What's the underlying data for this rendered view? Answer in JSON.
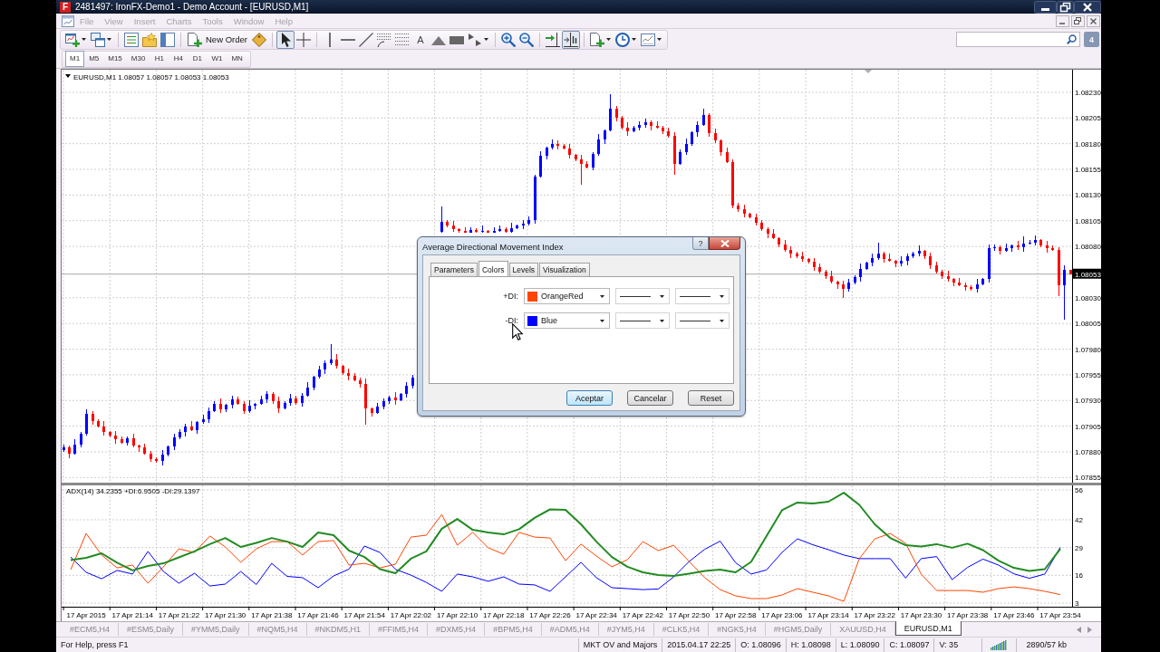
{
  "window": {
    "logo": "F",
    "title": "2481497: IronFX-Demo1 - Demo Account - [EURUSD,M1]"
  },
  "menu": [
    {
      "label": "File",
      "disabled": true
    },
    {
      "label": "View",
      "disabled": true
    },
    {
      "label": "Insert",
      "disabled": true
    },
    {
      "label": "Charts",
      "disabled": true
    },
    {
      "label": "Tools",
      "disabled": true
    },
    {
      "label": "Window",
      "disabled": true
    },
    {
      "label": "Help",
      "disabled": true
    }
  ],
  "toolbar": [
    {
      "kind": "tool",
      "selected": false,
      "dropdown": true
    },
    {
      "kind": "tool",
      "selected": false,
      "dropdown": true
    },
    {
      "kind": "separator"
    },
    {
      "kind": "tool",
      "selected": false
    },
    {
      "kind": "tool",
      "selected": false
    },
    {
      "kind": "tool",
      "selected": false
    },
    {
      "kind": "separator"
    },
    {
      "kind": "button",
      "label": "New Order"
    },
    {
      "kind": "tool",
      "selected": false
    },
    {
      "kind": "separator"
    },
    {
      "kind": "tool",
      "selected": true
    },
    {
      "kind": "tool",
      "selected": false
    },
    {
      "kind": "separator"
    },
    {
      "kind": "tool",
      "selected": false
    },
    {
      "kind": "tool",
      "selected": false
    },
    {
      "kind": "tool",
      "selected": false
    },
    {
      "kind": "tool",
      "selected": false
    },
    {
      "kind": "tool",
      "selected": false
    },
    {
      "kind": "text",
      "label": "A",
      "selected": false
    },
    {
      "kind": "tool",
      "selected": false
    },
    {
      "kind": "tool",
      "selected": false
    },
    {
      "kind": "tool",
      "selected": false,
      "dropdown": true
    },
    {
      "kind": "separator"
    },
    {
      "kind": "tool",
      "selected": false
    },
    {
      "kind": "tool",
      "selected": false
    },
    {
      "kind": "separator"
    },
    {
      "kind": "tool",
      "selected": false
    },
    {
      "kind": "tool",
      "selected": true
    },
    {
      "kind": "separator"
    },
    {
      "kind": "tool",
      "selected": false,
      "dropdown": true
    },
    {
      "kind": "tool",
      "selected": false,
      "dropdown": true
    },
    {
      "kind": "tool",
      "selected": false,
      "dropdown": true
    }
  ],
  "messages": {
    "count": "4"
  },
  "timeframes": [
    {
      "label": "M1",
      "selected": true
    },
    {
      "label": "M5",
      "selected": false
    },
    {
      "label": "M15",
      "selected": false
    },
    {
      "label": "M30",
      "selected": false
    },
    {
      "label": "H1",
      "selected": false
    },
    {
      "label": "H4",
      "selected": false
    },
    {
      "label": "D1",
      "selected": false
    },
    {
      "label": "W1",
      "selected": false
    },
    {
      "label": "MN",
      "selected": false
    }
  ],
  "chart": {
    "header": "EURUSD,M1 1.08057 1.08057 1.08053 1.08053",
    "chart_data": {
      "type": "candlestick",
      "grid": true,
      "ylim": [
        1.0785,
        1.08252
      ],
      "yticks": [
        {
          "value": 1.0823,
          "label": "1.08230"
        },
        {
          "value": 1.08205,
          "label": "1.08205"
        },
        {
          "value": 1.0818,
          "label": "1.08180"
        },
        {
          "value": 1.08155,
          "label": "1.08155"
        },
        {
          "value": 1.0813,
          "label": "1.08130"
        },
        {
          "value": 1.08105,
          "label": "1.08105"
        },
        {
          "value": 1.0808,
          "label": "1.08080"
        },
        {
          "value": 1.0803,
          "label": "1.08030"
        },
        {
          "value": 1.08005,
          "label": "1.08005"
        },
        {
          "value": 1.0798,
          "label": "1.07980"
        },
        {
          "value": 1.07955,
          "label": "1.07955"
        },
        {
          "value": 1.0793,
          "label": "1.07930"
        },
        {
          "value": 1.07905,
          "label": "1.07905"
        },
        {
          "value": 1.0788,
          "label": "1.07880"
        },
        {
          "value": 1.07855,
          "label": "1.07855"
        }
      ],
      "ref_lines": [
        {
          "axis": "y",
          "value": 1.08053,
          "label": "1.08053"
        }
      ],
      "categories": [
        null,
        null,
        null,
        null,
        null,
        null,
        null,
        null,
        null,
        null,
        null,
        null,
        null,
        null,
        null,
        null,
        null,
        null,
        null,
        null,
        null,
        null,
        null,
        null,
        null,
        null,
        null,
        null,
        null,
        null,
        null,
        null,
        null,
        null,
        null,
        null,
        null,
        null,
        null,
        null,
        null,
        null,
        null,
        null,
        null,
        null,
        null,
        null,
        null,
        null,
        null,
        null,
        null,
        null,
        null,
        null,
        null,
        null,
        null,
        null,
        null,
        null,
        null,
        null,
        null,
        null,
        null,
        null,
        null,
        null,
        null,
        null,
        null,
        null,
        null,
        null,
        null,
        null,
        null,
        null,
        null,
        null,
        null,
        null,
        null,
        null,
        null,
        null,
        null,
        null,
        null,
        null,
        null,
        null,
        null,
        null,
        null,
        null,
        null,
        null,
        null,
        null,
        null,
        null,
        null,
        null,
        null,
        null,
        null,
        null,
        null,
        null,
        null,
        null,
        null,
        null,
        null,
        null,
        null,
        null,
        null,
        null,
        null,
        null,
        null,
        null,
        null,
        null,
        null,
        null,
        null,
        null,
        null,
        null,
        null,
        null,
        null,
        null,
        null,
        null,
        null,
        null,
        null,
        null,
        null,
        null,
        null,
        null,
        null,
        null,
        null,
        null,
        null,
        null,
        null,
        null,
        null,
        null,
        null,
        null,
        null,
        null,
        null,
        null,
        null,
        null,
        null,
        null,
        null,
        null,
        null,
        null,
        null,
        null
      ],
      "ohlc": [
        [
          1.07882,
          1.07887,
          1.0788,
          1.07884
        ],
        [
          1.07884,
          1.07886,
          1.07874,
          1.07878
        ],
        [
          1.07878,
          1.07892,
          1.07877,
          1.07887
        ],
        [
          1.07887,
          1.07899,
          1.07884,
          1.07898
        ],
        [
          1.07898,
          1.07921,
          1.07896,
          1.07917
        ],
        [
          1.07917,
          1.0792,
          1.07906,
          1.0791
        ],
        [
          1.0791,
          1.07912,
          1.07904,
          1.07905
        ],
        [
          1.07905,
          1.0791,
          1.07896,
          1.07899
        ],
        [
          1.07899,
          1.079,
          1.07894,
          1.07896
        ],
        [
          1.07896,
          1.079,
          1.07888,
          1.07892
        ],
        [
          1.07892,
          1.07895,
          1.07888,
          1.07889
        ],
        [
          1.07889,
          1.07895,
          1.07886,
          1.07893
        ],
        [
          1.07893,
          1.07898,
          1.07884,
          1.07886
        ],
        [
          1.07886,
          1.07887,
          1.0788,
          1.07884
        ],
        [
          1.07884,
          1.07888,
          1.07877,
          1.07878
        ],
        [
          1.07878,
          1.07881,
          1.0787,
          1.07873
        ],
        [
          1.07873,
          1.07875,
          1.07869,
          1.07871
        ],
        [
          1.07871,
          1.07882,
          1.07867,
          1.07877
        ],
        [
          1.07877,
          1.07886,
          1.07876,
          1.07885
        ],
        [
          1.07885,
          1.07898,
          1.07882,
          1.07894
        ],
        [
          1.07894,
          1.07902,
          1.07892,
          1.07899
        ],
        [
          1.07899,
          1.07907,
          1.07895,
          1.07905
        ],
        [
          1.07905,
          1.0791,
          1.079,
          1.07901
        ],
        [
          1.07901,
          1.0791,
          1.07898,
          1.07909
        ],
        [
          1.07909,
          1.07916,
          1.07907,
          1.07912
        ],
        [
          1.07912,
          1.07923,
          1.07908,
          1.0792
        ],
        [
          1.0792,
          1.07929,
          1.07919,
          1.07927
        ],
        [
          1.07927,
          1.07932,
          1.07918,
          1.07921
        ],
        [
          1.07921,
          1.07927,
          1.07919,
          1.07926
        ],
        [
          1.07926,
          1.07935,
          1.07922,
          1.07931
        ],
        [
          1.07931,
          1.07934,
          1.07926,
          1.07927
        ],
        [
          1.07927,
          1.07929,
          1.07917,
          1.0792
        ],
        [
          1.0792,
          1.0793,
          1.07918,
          1.07925
        ],
        [
          1.07925,
          1.07928,
          1.07921,
          1.07927
        ],
        [
          1.07927,
          1.07935,
          1.07926,
          1.07931
        ],
        [
          1.07931,
          1.07939,
          1.07928,
          1.07936
        ],
        [
          1.07936,
          1.07938,
          1.07927,
          1.07929
        ],
        [
          1.07929,
          1.07934,
          1.07918,
          1.07922
        ],
        [
          1.07922,
          1.07929,
          1.07921,
          1.07928
        ],
        [
          1.07928,
          1.07936,
          1.07925,
          1.07932
        ],
        [
          1.07932,
          1.07935,
          1.07926,
          1.07928
        ],
        [
          1.07928,
          1.07937,
          1.07924,
          1.07935
        ],
        [
          1.07935,
          1.07948,
          1.07934,
          1.07943
        ],
        [
          1.07943,
          1.07954,
          1.0794,
          1.07953
        ],
        [
          1.07953,
          1.07964,
          1.07951,
          1.0796
        ],
        [
          1.0796,
          1.07969,
          1.07956,
          1.07966
        ],
        [
          1.07966,
          1.07985,
          1.07965,
          1.0797
        ],
        [
          1.0797,
          1.07975,
          1.07961,
          1.07964
        ],
        [
          1.07964,
          1.07965,
          1.07955,
          1.07957
        ],
        [
          1.07957,
          1.07961,
          1.0795,
          1.07954
        ],
        [
          1.07954,
          1.07957,
          1.07949,
          1.0795
        ],
        [
          1.0795,
          1.07952,
          1.07943,
          1.07946
        ],
        [
          1.07946,
          1.07951,
          1.07906,
          1.07922
        ],
        [
          1.07922,
          1.07923,
          1.07914,
          1.07918
        ],
        [
          1.07918,
          1.07928,
          1.07917,
          1.07924
        ],
        [
          1.07924,
          1.07932,
          1.07921,
          1.07929
        ],
        [
          1.07929,
          1.07935,
          1.07927,
          1.07933
        ],
        [
          1.07933,
          1.07938,
          1.07926,
          1.0793
        ],
        [
          1.0793,
          1.07937,
          1.07929,
          1.07936
        ],
        [
          1.07936,
          1.07948,
          1.07933,
          1.07944
        ],
        [
          1.07944,
          1.07955,
          1.07942,
          1.07952
        ],
        null,
        null,
        null,
        null,
        [
          1.08094,
          1.08119,
          1.08093,
          1.08104
        ],
        [
          1.08104,
          1.08106,
          1.08099,
          1.081
        ],
        [
          1.081,
          1.08105,
          1.08094,
          1.08097
        ],
        [
          1.08097,
          1.08098,
          1.08093,
          1.08095
        ],
        [
          1.08095,
          1.08099,
          1.08093,
          1.08093
        ],
        [
          1.08093,
          1.08099,
          1.08093,
          1.08096
        ],
        [
          1.08096,
          1.08098,
          1.08093,
          1.08094
        ],
        [
          1.08094,
          1.081,
          1.08093,
          1.08095
        ],
        [
          1.08095,
          1.08096,
          1.08093,
          1.08093
        ],
        [
          1.08093,
          1.08099,
          1.08093,
          1.08095
        ],
        [
          1.08095,
          1.081,
          1.08094,
          1.08097
        ],
        [
          1.08097,
          1.08099,
          1.08093,
          1.08094
        ],
        [
          1.08094,
          1.08103,
          1.08093,
          1.08098
        ],
        [
          1.08098,
          1.08101,
          1.08097,
          1.081
        ],
        [
          1.081,
          1.08106,
          1.08097,
          1.08102
        ],
        [
          1.08102,
          1.08109,
          1.081,
          1.08106
        ],
        [
          1.08106,
          1.0815,
          1.08102,
          1.08148
        ],
        [
          1.08148,
          1.08173,
          1.08147,
          1.08168
        ],
        [
          1.08168,
          1.08177,
          1.08165,
          1.08176
        ],
        [
          1.08176,
          1.08184,
          1.08174,
          1.0818
        ],
        [
          1.0818,
          1.08183,
          1.08174,
          1.08178
        ],
        [
          1.08178,
          1.0818,
          1.08174,
          1.08175
        ],
        [
          1.08175,
          1.0818,
          1.08166,
          1.08169
        ],
        [
          1.08169,
          1.0817,
          1.08163,
          1.08165
        ],
        [
          1.08165,
          1.08169,
          1.0814,
          1.0816
        ],
        [
          1.0816,
          1.08163,
          1.08156,
          1.08157
        ],
        [
          1.08157,
          1.08172,
          1.08154,
          1.0817
        ],
        [
          1.0817,
          1.08189,
          1.08168,
          1.08184
        ],
        [
          1.08184,
          1.08194,
          1.0818,
          1.08193
        ],
        [
          1.08193,
          1.08228,
          1.08192,
          1.08214
        ],
        [
          1.08214,
          1.08217,
          1.08202,
          1.08205
        ],
        [
          1.08205,
          1.08207,
          1.08194,
          1.08196
        ],
        [
          1.08196,
          1.08201,
          1.08188,
          1.08192
        ],
        [
          1.08192,
          1.08197,
          1.08191,
          1.08196
        ],
        [
          1.08196,
          1.08202,
          1.08193,
          1.08198
        ],
        [
          1.08198,
          1.08204,
          1.08196,
          1.08201
        ],
        [
          1.08201,
          1.08203,
          1.08193,
          1.08197
        ],
        [
          1.08197,
          1.08202,
          1.08195,
          1.08196
        ],
        [
          1.08196,
          1.08197,
          1.08189,
          1.08192
        ],
        [
          1.08192,
          1.08196,
          1.08186,
          1.08188
        ],
        [
          1.08188,
          1.08191,
          1.0815,
          1.0816
        ],
        [
          1.0816,
          1.08174,
          1.08159,
          1.08172
        ],
        [
          1.08172,
          1.08185,
          1.08169,
          1.0818
        ],
        [
          1.0818,
          1.08192,
          1.08178,
          1.08191
        ],
        [
          1.08191,
          1.08202,
          1.08187,
          1.08198
        ],
        [
          1.08198,
          1.08214,
          1.08197,
          1.08208
        ],
        [
          1.08208,
          1.0821,
          1.08187,
          1.0819
        ],
        [
          1.0819,
          1.08195,
          1.08181,
          1.08183
        ],
        [
          1.08183,
          1.08184,
          1.08168,
          1.08172
        ],
        [
          1.08172,
          1.08176,
          1.08161,
          1.08162
        ],
        [
          1.08162,
          1.08165,
          1.08117,
          1.0812
        ],
        [
          1.0812,
          1.08122,
          1.08114,
          1.08116
        ],
        [
          1.08116,
          1.08121,
          1.08108,
          1.08112
        ],
        [
          1.08112,
          1.08113,
          1.08107,
          1.08108
        ],
        [
          1.08108,
          1.08112,
          1.081,
          1.08103
        ],
        [
          1.08103,
          1.08106,
          1.08095,
          1.08097
        ],
        [
          1.08097,
          1.08099,
          1.08088,
          1.08092
        ],
        [
          1.08092,
          1.08097,
          1.08087,
          1.08088
        ],
        [
          1.08088,
          1.08089,
          1.08079,
          1.08082
        ],
        [
          1.08082,
          1.08086,
          1.08075,
          1.08077
        ],
        [
          1.08077,
          1.0808,
          1.08069,
          1.08073
        ],
        [
          1.08073,
          1.08075,
          1.08069,
          1.0807
        ],
        [
          1.0807,
          1.08075,
          1.08065,
          1.08068
        ],
        [
          1.08068,
          1.08069,
          1.08063,
          1.08065
        ],
        [
          1.08065,
          1.08069,
          1.08056,
          1.0806
        ],
        [
          1.0806,
          1.08063,
          1.08054,
          1.08055
        ],
        [
          1.08055,
          1.08057,
          1.08048,
          1.08051
        ],
        [
          1.08051,
          1.08056,
          1.08044,
          1.08046
        ],
        [
          1.08046,
          1.08047,
          1.08039,
          1.08043
        ],
        [
          1.08043,
          1.08047,
          1.0803,
          1.08039
        ],
        [
          1.08039,
          1.08048,
          1.08036,
          1.08045
        ],
        [
          1.08045,
          1.08052,
          1.08043,
          1.0805
        ],
        [
          1.0805,
          1.08063,
          1.08046,
          1.08058
        ],
        [
          1.08058,
          1.08065,
          1.08057,
          1.08064
        ],
        [
          1.08064,
          1.08073,
          1.08061,
          1.08069
        ],
        [
          1.08069,
          1.08084,
          1.08067,
          1.08073
        ],
        [
          1.08073,
          1.08075,
          1.08064,
          1.08068
        ],
        [
          1.08068,
          1.08073,
          1.08065,
          1.08066
        ],
        [
          1.08066,
          1.08067,
          1.0806,
          1.08063
        ],
        [
          1.08063,
          1.0807,
          1.08061,
          1.08066
        ],
        [
          1.08066,
          1.08073,
          1.08062,
          1.0807
        ],
        [
          1.0807,
          1.08075,
          1.08069,
          1.08073
        ],
        [
          1.08073,
          1.08081,
          1.0807,
          1.08076
        ],
        [
          1.08076,
          1.08077,
          1.08068,
          1.0807
        ],
        [
          1.0807,
          1.08074,
          1.08058,
          1.08062
        ],
        [
          1.08062,
          1.08065,
          1.08054,
          1.08055
        ],
        [
          1.08055,
          1.08057,
          1.08048,
          1.08051
        ],
        [
          1.08051,
          1.08056,
          1.08046,
          1.08048
        ],
        [
          1.08048,
          1.08049,
          1.08041,
          1.08045
        ],
        [
          1.08045,
          1.08049,
          1.08041,
          1.08042
        ],
        [
          1.08042,
          1.08045,
          1.08037,
          1.0804
        ],
        [
          1.0804,
          1.08042,
          1.08037,
          1.08039
        ],
        [
          1.08039,
          1.08048,
          1.08035,
          1.08043
        ],
        [
          1.08043,
          1.08049,
          1.08042,
          1.08048
        ],
        [
          1.08048,
          1.08082,
          1.08045,
          1.08078
        ],
        [
          1.08078,
          1.08082,
          1.08076,
          1.08079
        ],
        [
          1.08079,
          1.08081,
          1.08072,
          1.08076
        ],
        [
          1.08076,
          1.08083,
          1.08075,
          1.08078
        ],
        [
          1.08078,
          1.08082,
          1.08075,
          1.08081
        ],
        [
          1.08081,
          1.08085,
          1.08077,
          1.08079
        ],
        [
          1.08079,
          1.0809,
          1.08075,
          1.08083
        ],
        [
          1.08083,
          1.08086,
          1.08082,
          1.08084
        ],
        [
          1.08084,
          1.08091,
          1.08081,
          1.08086
        ],
        [
          1.08086,
          1.08087,
          1.08079,
          1.08081
        ],
        [
          1.08081,
          1.08085,
          1.08074,
          1.08078
        ],
        [
          1.08078,
          1.08081,
          1.08076,
          1.08077
        ],
        [
          1.08077,
          1.08079,
          1.08032,
          1.08042
        ],
        [
          1.08042,
          1.08062,
          1.08009,
          1.08057
        ],
        [
          1.08057,
          1.08057,
          1.08053,
          1.08053
        ]
      ]
    }
  },
  "indicator": {
    "chart_data": {
      "type": "line",
      "grid": true,
      "title": "ADX(14) 34.2355 +DI:6.9505 -DI:29.1397",
      "ylim": [
        1.3,
        57.7
      ],
      "yticks": [
        3,
        16,
        29,
        42,
        56
      ],
      "categories": [
        null,
        "17 Apr 2015",
        null,
        null,
        "17 Apr 21:14",
        null,
        null,
        "17 Apr 21:22",
        null,
        null,
        "17 Apr 21:30",
        null,
        null,
        "17 Apr 21:38",
        null,
        null,
        "17 Apr 21:46",
        null,
        null,
        "17 Apr 21:54",
        null,
        null,
        "17 Apr 22:02",
        null,
        null,
        "17 Apr 22:10",
        null,
        null,
        "17 Apr 22:18",
        null,
        null,
        "17 Apr 22:26",
        null,
        null,
        "17 Apr 22:34",
        null,
        null,
        "17 Apr 22:42",
        null,
        null,
        "17 Apr 22:50",
        null,
        null,
        "17 Apr 22:58",
        null,
        null,
        "17 Apr 23:06",
        null,
        null,
        "17 Apr 23:14",
        null,
        null,
        "17 Apr 23:22",
        null,
        null,
        "17 Apr 23:30",
        null,
        null,
        "17 Apr 23:38",
        null,
        null,
        "17 Apr 23:46",
        null,
        null,
        "17 Apr 23:54"
      ],
      "series": [
        {
          "color": "#228b22",
          "values": [
            23.1,
            24.2,
            26.3,
            21.9,
            18.3,
            20.4,
            21.6,
            24.4,
            27.2,
            30.6,
            33.5,
            29.3,
            31.2,
            33.5,
            31.8,
            29.3,
            36.1,
            34.8,
            27.6,
            24.6,
            18.9,
            17.0,
            23.8,
            27.2,
            37.8,
            42.4,
            37.3,
            36.1,
            35.2,
            37.6,
            42.9,
            46.9,
            46.7,
            39.9,
            31.8,
            24.6,
            20.0,
            17.4,
            16.1,
            15.7,
            16.8,
            18.0,
            18.7,
            17.4,
            22.3,
            34.4,
            46.5,
            50.1,
            49.6,
            50.5,
            54.7,
            49.0,
            39.9,
            33.5,
            30.1,
            29.5,
            30.6,
            28.9,
            30.8,
            27.8,
            22.9,
            19.5,
            18.0,
            18.9,
            28.4
          ]
        },
        {
          "color": "#ff4500",
          "values": [
            18.7,
            35.6,
            25.5,
            19.5,
            20.8,
            12.3,
            20.0,
            28.4,
            26.7,
            34.4,
            29.3,
            22.1,
            28.4,
            31.8,
            31.8,
            25.5,
            31.8,
            32.3,
            20.8,
            21.6,
            19.5,
            21.2,
            33.9,
            34.8,
            44.5,
            30.1,
            36.1,
            28.9,
            25.9,
            36.1,
            33.9,
            33.5,
            22.9,
            30.6,
            25.0,
            20.0,
            23.3,
            31.8,
            27.6,
            30.1,
            22.5,
            14.9,
            9.3,
            6.4,
            5.1,
            5.1,
            6.8,
            9.8,
            8.1,
            6.4,
            3.8,
            23.8,
            33.1,
            35.6,
            31.0,
            16.6,
            8.9,
            8.9,
            8.9,
            8.1,
            9.8,
            10.6,
            9.8,
            8.5,
            7.0
          ]
        },
        {
          "color": "#0000ff",
          "values": [
            24.6,
            17.4,
            14.4,
            18.3,
            16.6,
            27.2,
            17.8,
            12.3,
            17.0,
            11.0,
            11.9,
            17.8,
            11.7,
            21.6,
            15.5,
            14.9,
            10.2,
            15.7,
            18.9,
            29.7,
            26.7,
            18.8,
            16.1,
            12.7,
            8.5,
            16.6,
            15.3,
            13.2,
            15.3,
            11.9,
            11.5,
            8.5,
            15.3,
            22.1,
            14.9,
            10.2,
            9.8,
            9.3,
            9.6,
            15.3,
            22.5,
            28.2,
            32.0,
            21.9,
            16.6,
            18.5,
            26.7,
            33.1,
            30.3,
            28.0,
            25.5,
            23.8,
            23.8,
            23.8,
            14.7,
            23.8,
            24.8,
            14.0,
            19.7,
            23.6,
            20.8,
            16.7,
            14.6,
            16.6,
            29.1
          ]
        }
      ]
    }
  },
  "symbol_tabs": [
    {
      "label": "#ECM5,H4",
      "selected": false
    },
    {
      "label": "#ESM5,Daily",
      "selected": false
    },
    {
      "label": "#YMM5,Daily",
      "selected": false
    },
    {
      "label": "#NQM5,H4",
      "selected": false
    },
    {
      "label": "#NKDM5,H1",
      "selected": false
    },
    {
      "label": "#FFIM5,H4",
      "selected": false
    },
    {
      "label": "#DXM5,H4",
      "selected": false
    },
    {
      "label": "#BPM5,H4",
      "selected": false
    },
    {
      "label": "#ADM5,H4",
      "selected": false
    },
    {
      "label": "#JYM5,H4",
      "selected": false
    },
    {
      "label": "#CLK5,H4",
      "selected": false
    },
    {
      "label": "#NGK5,H4",
      "selected": false
    },
    {
      "label": "#HGM5,Daily",
      "selected": false
    },
    {
      "label": "XAUUSD,H4",
      "selected": false
    },
    {
      "label": "EURUSD,M1",
      "selected": true
    }
  ],
  "status_bar": {
    "help": "For Help, press F1",
    "cells": [
      "MKT OV and Majors",
      "2015.04.17 22:25",
      "O: 1.08096",
      "H: 1.08098",
      "L: 1.08090",
      "C: 1.08097",
      "V: 35"
    ],
    "traffic": "2890/57 kb"
  },
  "dialog": {
    "title": "Average Directional Movement Index",
    "help": "?",
    "tabs": [
      {
        "label": "Parameters",
        "selected": false
      },
      {
        "label": "Colors",
        "selected": true
      },
      {
        "label": "Levels",
        "selected": false
      },
      {
        "label": "Visualization",
        "selected": false
      }
    ],
    "rows": [
      {
        "label": "+DI:",
        "color": "#ff4500",
        "color_name": "OrangeRed"
      },
      {
        "label": "-DI:",
        "color": "#0000ff",
        "color_name": "Blue"
      }
    ],
    "buttons": [
      {
        "label": "Aceptar",
        "default": true
      },
      {
        "label": "Cancelar",
        "default": false
      },
      {
        "label": "Reset",
        "default": false
      }
    ]
  }
}
